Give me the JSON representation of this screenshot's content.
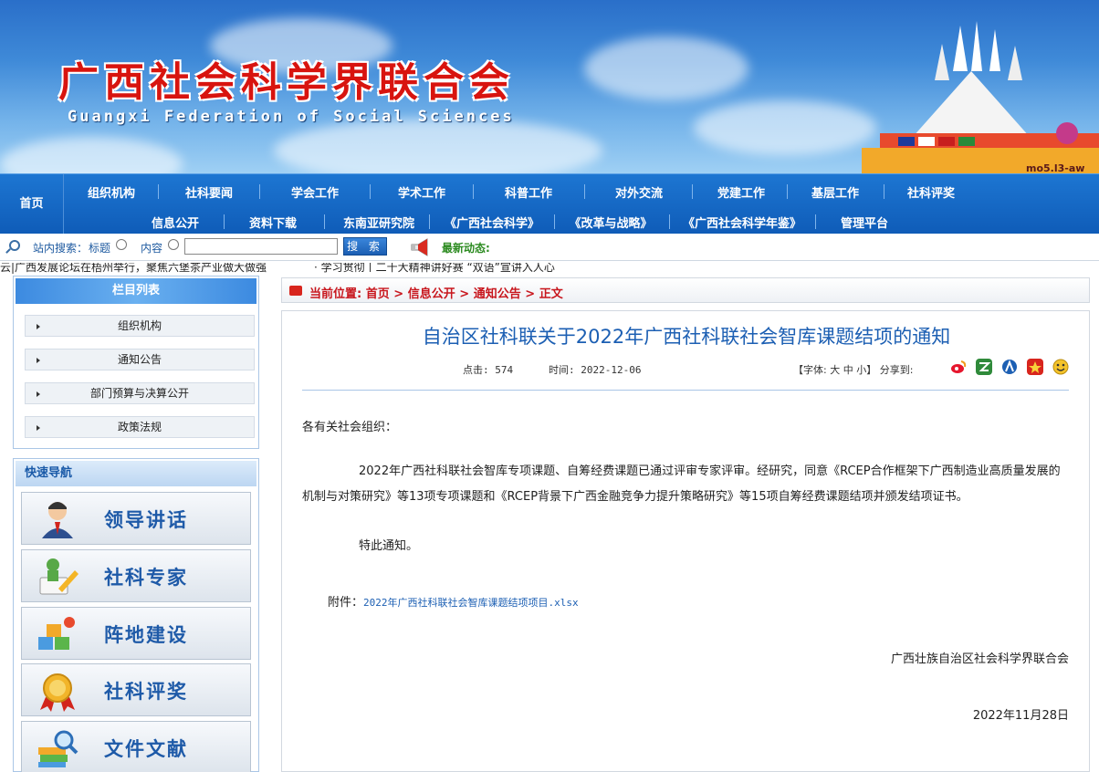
{
  "banner": {
    "title": "广西社会科学界联合会",
    "subtitle": "Guangxi Federation of Social Sciences",
    "stadium_label": "mo5.l3-aw"
  },
  "nav": {
    "home": "首页",
    "row1": [
      "组织机构",
      "社科要闻",
      "学会工作",
      "学术工作",
      "科普工作",
      "对外交流",
      "党建工作",
      "基层工作",
      "社科评奖"
    ],
    "row2": [
      "信息公开",
      "资料下载",
      "东南亚研究院",
      "《广西社会科学》",
      "《改革与战略》",
      "《广西社会科学年鉴》",
      "管理平台"
    ]
  },
  "search": {
    "label": "站内搜索：",
    "opt_title": "标题",
    "opt_content": "内容",
    "input_value": "",
    "button": "搜 索",
    "latest_label": "最新动态:"
  },
  "marquee": {
    "left_text": "云|广西发展论坛在梧州举行，聚焦六堡茶产业做大做强",
    "right_text": "· 学习贯彻丨二十大精神讲好赛 “双语”宣讲入人心"
  },
  "sidebar": {
    "header": "栏目列表",
    "items": [
      "组织机构",
      "通知公告",
      "部门预算与决算公开",
      "政策法规"
    ]
  },
  "quicknav": {
    "header": "快速导航",
    "items": [
      "领导讲话",
      "社科专家",
      "阵地建设",
      "社科评奖",
      "文件文献"
    ]
  },
  "breadcrumb": {
    "label": "当前位置:",
    "path": [
      "首页",
      "信息公开",
      "通知公告",
      "正文"
    ],
    "sep": ">"
  },
  "article": {
    "title": "自治区社科联关于2022年广西社科联社会智库课题结项的通知",
    "clicks_label": "点击:",
    "clicks": "574",
    "time_label": "时间:",
    "time": "2022-12-06",
    "font_label": "【字体:",
    "font_big": "大",
    "font_mid": "中",
    "font_small": "小】",
    "share_label": "分享到:",
    "salutation": "各有关社会组织：",
    "body": "2022年广西社科联社会智库专项课题、自筹经费课题已通过评审专家评审。经研究，同意《RCEP合作框架下广西制造业高质量发展的机制与对策研究》等13项专项课题和《RCEP背景下广西金融竞争力提升策略研究》等15项自筹经费课题结项并颁发结项证书。",
    "notice": "特此通知。",
    "attach_label": "附件：",
    "attach_file": "2022年广西社科联社会智库课题结项项目.xlsx",
    "signer": "广西壮族自治区社会科学界联合会",
    "date": "2022年11月28日"
  },
  "colors": {
    "nav_blue": "#0f5cb8",
    "title_red": "#d8140f",
    "link_blue": "#1c5fb3",
    "latest_green": "#2b8a1f"
  }
}
